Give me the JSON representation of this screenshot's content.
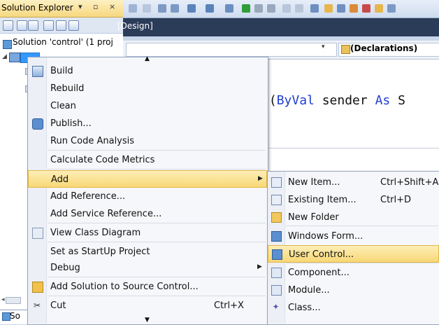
{
  "solution_explorer": {
    "title": "Solution Explorer",
    "controls": "▾ ▫ ×",
    "solution_node": "Solution 'control' (1 proj",
    "bottom_tab": "So"
  },
  "editor": {
    "tab_label": "[Design]",
    "declarations_label": "(Declarations)",
    "code": {
      "t1": "d(",
      "kw1": "ByVal",
      "t2": " sender ",
      "kw2": "As",
      "t3": " S"
    }
  },
  "context_menu": {
    "items": [
      {
        "label": "Build",
        "icon": "build-icon"
      },
      {
        "label": "Rebuild"
      },
      {
        "label": "Clean"
      },
      {
        "label": "Publish...",
        "icon": "publish-icon"
      },
      {
        "label": "Run Code Analysis"
      },
      {
        "label": "Calculate Code Metrics"
      },
      {
        "label": "Add",
        "has_submenu": true,
        "selected": true
      },
      {
        "label": "Add Reference..."
      },
      {
        "label": "Add Service Reference..."
      },
      {
        "label": "View Class Diagram",
        "icon": "class-diagram-icon"
      },
      {
        "label": "Set as StartUp Project"
      },
      {
        "label": "Debug",
        "has_submenu": true
      },
      {
        "label": "Add Solution to Source Control...",
        "icon": "source-control-icon"
      },
      {
        "label": "Cut",
        "shortcut": "Ctrl+X",
        "icon": "scissors-icon"
      }
    ]
  },
  "add_submenu": {
    "items": [
      {
        "label": "New Item...",
        "shortcut": "Ctrl+Shift+A",
        "icon": "new-item-icon"
      },
      {
        "label": "Existing Item...",
        "shortcut": "Ctrl+D",
        "icon": "existing-item-icon"
      },
      {
        "label": "New Folder",
        "icon": "folder-icon"
      },
      {
        "label": "Windows Form...",
        "icon": "windows-form-icon"
      },
      {
        "label": "User Control...",
        "icon": "user-control-icon",
        "selected": true
      },
      {
        "label": "Component...",
        "icon": "component-icon"
      },
      {
        "label": "Module...",
        "icon": "module-icon"
      },
      {
        "label": "Class...",
        "icon": "class-icon"
      }
    ]
  },
  "colors": {
    "menu_highlight": "#f8d776",
    "tab_strip": "#2b3c59",
    "keyword": "#1f3fd0"
  }
}
